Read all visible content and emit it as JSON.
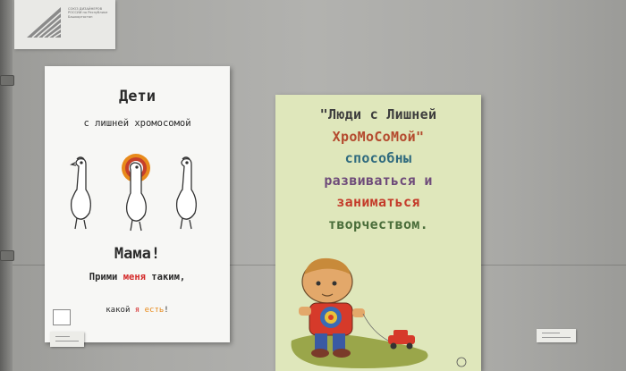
{
  "logo_sign": {
    "text": "СОЮЗ ДИЗАЙНЕРОВ РОССИИ по Республике Башкортостан"
  },
  "poster_left": {
    "title": "Дети",
    "subtitle": "с лишней хромосомой",
    "exclaim": "Мама!",
    "line1_a": "Прими ",
    "line1_b": "меня",
    "line1_c": " таким,",
    "line2_a": "какой ",
    "line2_b": "я",
    "line2_c": " есть",
    "line2_d": "!"
  },
  "poster_right": {
    "lines": [
      "\"Люди с Лишней",
      "ХроМоСоМой\"",
      "способны",
      "развиваться и",
      "заниматься",
      "творчеством."
    ]
  },
  "colors": {
    "wall": "#b2b2af",
    "poster_left_bg": "#f7f7f5",
    "poster_right_bg": "#dfe7bb",
    "accent_red": "#d42a2a",
    "accent_orange": "#e88a1b"
  }
}
